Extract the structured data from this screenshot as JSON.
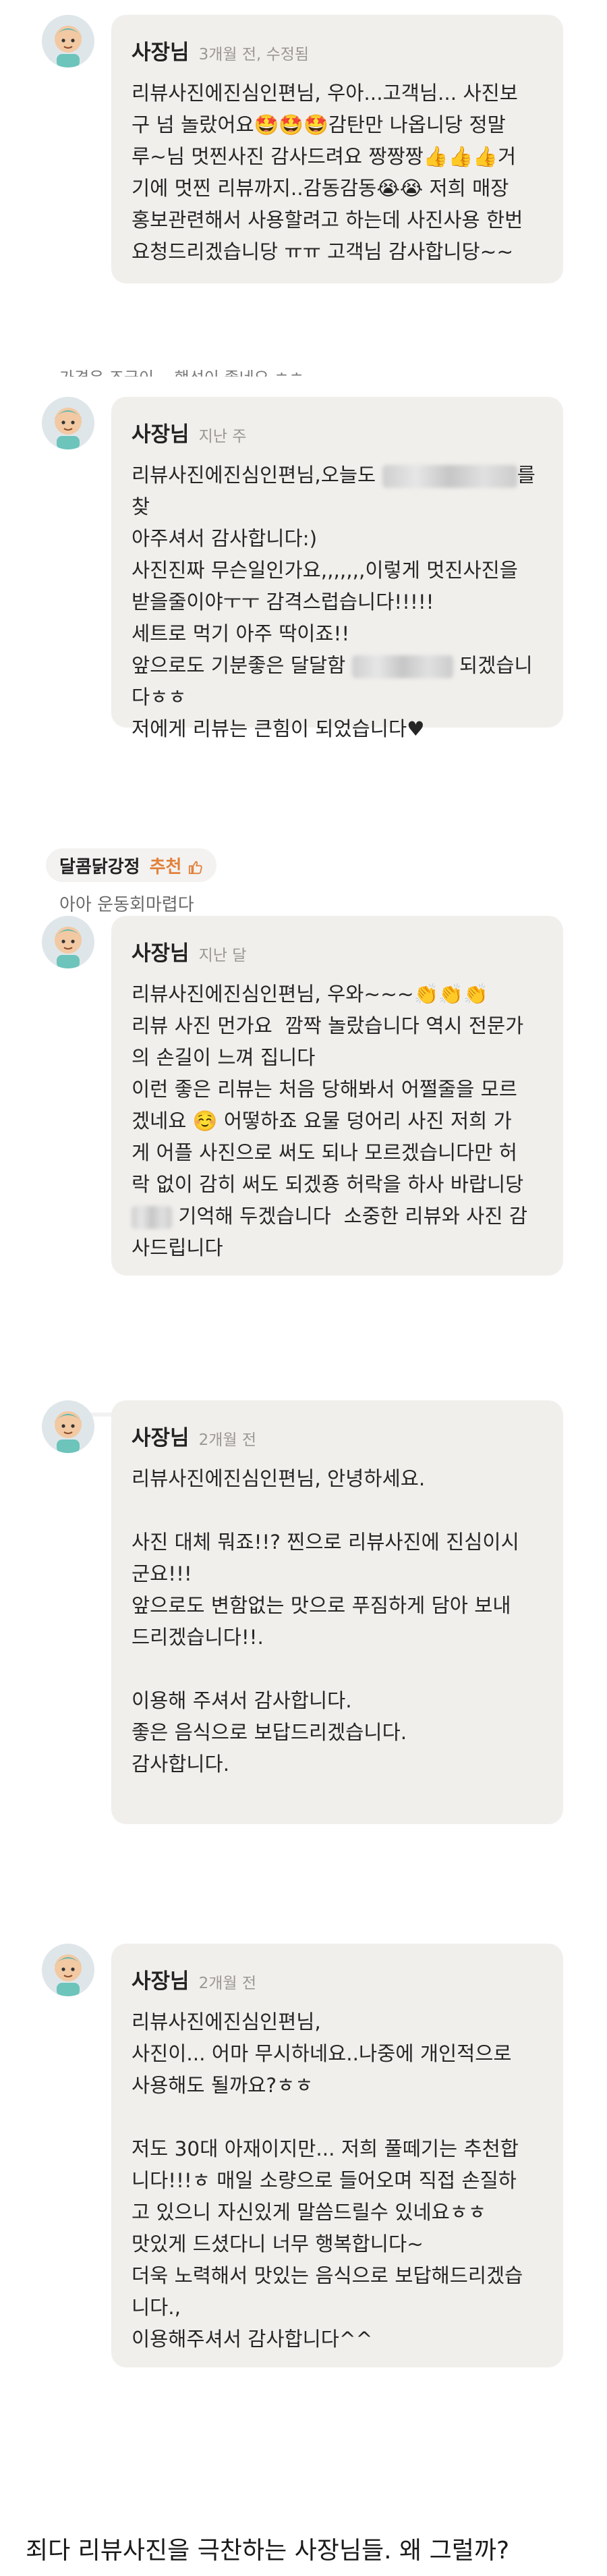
{
  "owner_label": "사장님",
  "reviews": [
    {
      "time": "3개월 전, 수정됨",
      "lines": [
        "리뷰사진에진심인편님, 우아...고객님... 사진보",
        "구 넘 놀랐어요🤩🤩🤩감탄만 나옵니당 정말",
        "루~님 멋찐사진 감사드려요 짱짱짱👍👍👍거",
        "기에 멋찐 리뷰까지..감동감동😭😭 저희 매장",
        "홍보관련해서 사용할려고 하는데 사진사용 한번",
        "요청드리겠습니당 ㅠㅠ 고객님 감사합니당~~"
      ]
    },
    {
      "time": "지난 주",
      "lines": [
        "리뷰사진에진심인편님,오늘도 ",
        "를 찾",
        "아주셔서 감사합니다:)",
        "사진진짜 무슨일인가요,,,,,,,이렇게 멋진사진을",
        "받을줄이야ㅜㅜ 감격스럽습니다!!!!!",
        "세트로 먹기 아주 딱이죠!!",
        "앞으로도 기분좋은 달달함 ",
        " 되겠습니",
        "다ㅎㅎ",
        "저에게 리뷰는 큰힘이 되었습니다♥"
      ]
    },
    {
      "time": "지난 달",
      "lines": [
        "리뷰사진에진심인편님, 우와~~~👏👏👏",
        "리뷰 사진 먼가요  깜짝 놀랐습니다 역시 전문가",
        "의 손길이 느껴 집니다",
        "이런 좋은 리뷰는 처음 당해봐서 어쩔줄을 모르",
        "겠네요 ☺️ 어떻하죠 요물 덩어리 사진 저희 가",
        "게 어플 사진으로 써도 되나 모르겠습니다만 허",
        "락 없이 감히 써도 되겠죵 허락을 하사 바랍니당",
        " 기억해 두겠습니다  소중한 리뷰와 사진 감",
        "사드립니다"
      ]
    },
    {
      "time": "2개월 전",
      "text": "리뷰사진에진심인편님, 안녕하세요.\n\n사진 대체 뭐죠!!? 찐으로 리뷰사진에 진심이시\n군요!!!\n앞으로도 변함없는 맛으로 푸짐하게 담아 보내\n드리겠습니다!!.\n\n이용해 주셔서 감사합니다.\n좋은 음식으로 보답드리겠습니다.\n감사합니다."
    },
    {
      "time": "2개월 전",
      "text": "리뷰사진에진심인편님,\n사진이... 어마 무시하네요..나중에 개인적으로\n사용해도 될까요?ㅎㅎ\n\n저도 30대 아재이지만... 저희 풀떼기는 추천합\n니다!!!ㅎ 매일 소량으로 들어오며 직접 손질하\n고 있으니 자신있게 말씀드릴수 있네요ㅎㅎ\n맛있게 드셨다니 너무 행복합니다~\n더욱 노력해서 맛있는 음식으로 보답해드리겠습\n니다.,\n이용해주셔서 감사합니다^^"
    }
  ],
  "partial_text": "가격은 조금이 ...행성이 좋네요 ㅎㅎ",
  "reviewer_badge": {
    "nickname": "달콤닭강정",
    "recommend": "추천",
    "review_text": "아아 운동회마렵다"
  },
  "caption": "죄다 리뷰사진을 극찬하는 사장님들. 왜 그럴까?",
  "icons": [
    "owner-avatar-icon",
    "thumbs-up-icon"
  ]
}
